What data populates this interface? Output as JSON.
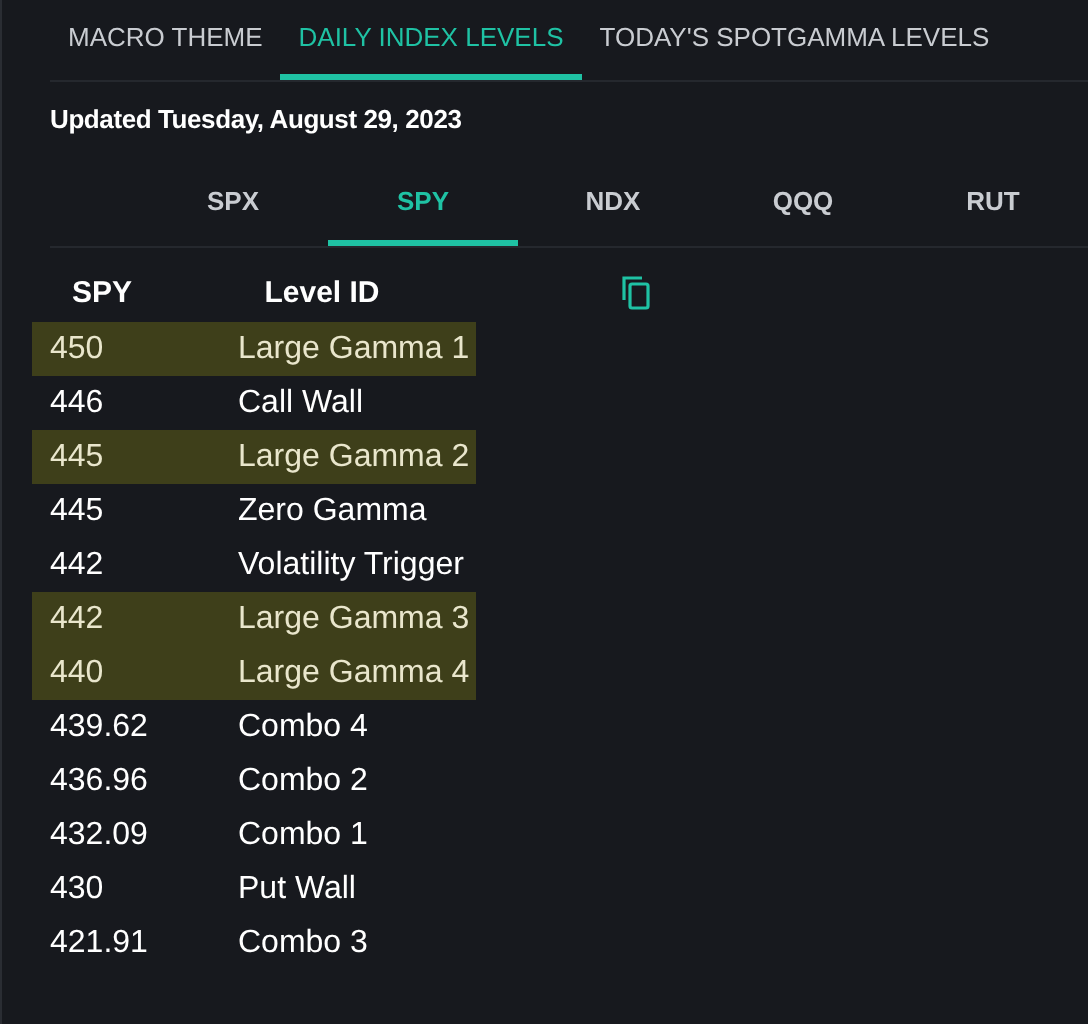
{
  "tabs": [
    {
      "label": "MACRO THEME",
      "selected": false
    },
    {
      "label": "DAILY INDEX LEVELS",
      "selected": true
    },
    {
      "label": "TODAY'S SPOTGAMMA LEVELS",
      "selected": false
    }
  ],
  "updated": "Updated Tuesday, August 29, 2023",
  "index_tabs": [
    {
      "label": "SPX",
      "selected": false
    },
    {
      "label": "SPY",
      "selected": true
    },
    {
      "label": "NDX",
      "selected": false
    },
    {
      "label": "QQQ",
      "selected": false
    },
    {
      "label": "RUT",
      "selected": false
    }
  ],
  "table": {
    "columns": [
      "SPY",
      "Level ID"
    ],
    "rows": [
      {
        "level": "450",
        "id": "Large Gamma 1",
        "highlighted": true
      },
      {
        "level": "446",
        "id": "Call Wall",
        "highlighted": false
      },
      {
        "level": "445",
        "id": "Large Gamma 2",
        "highlighted": true
      },
      {
        "level": "445",
        "id": "Zero Gamma",
        "highlighted": false
      },
      {
        "level": "442",
        "id": "Volatility Trigger",
        "highlighted": false
      },
      {
        "level": "442",
        "id": "Large Gamma 3",
        "highlighted": true
      },
      {
        "level": "440",
        "id": "Large Gamma 4",
        "highlighted": true
      },
      {
        "level": "439.62",
        "id": "Combo 4",
        "highlighted": false
      },
      {
        "level": "436.96",
        "id": "Combo 2",
        "highlighted": false
      },
      {
        "level": "432.09",
        "id": "Combo 1",
        "highlighted": false
      },
      {
        "level": "430",
        "id": "Put Wall",
        "highlighted": false
      },
      {
        "level": "421.91",
        "id": "Combo 3",
        "highlighted": false
      }
    ]
  }
}
